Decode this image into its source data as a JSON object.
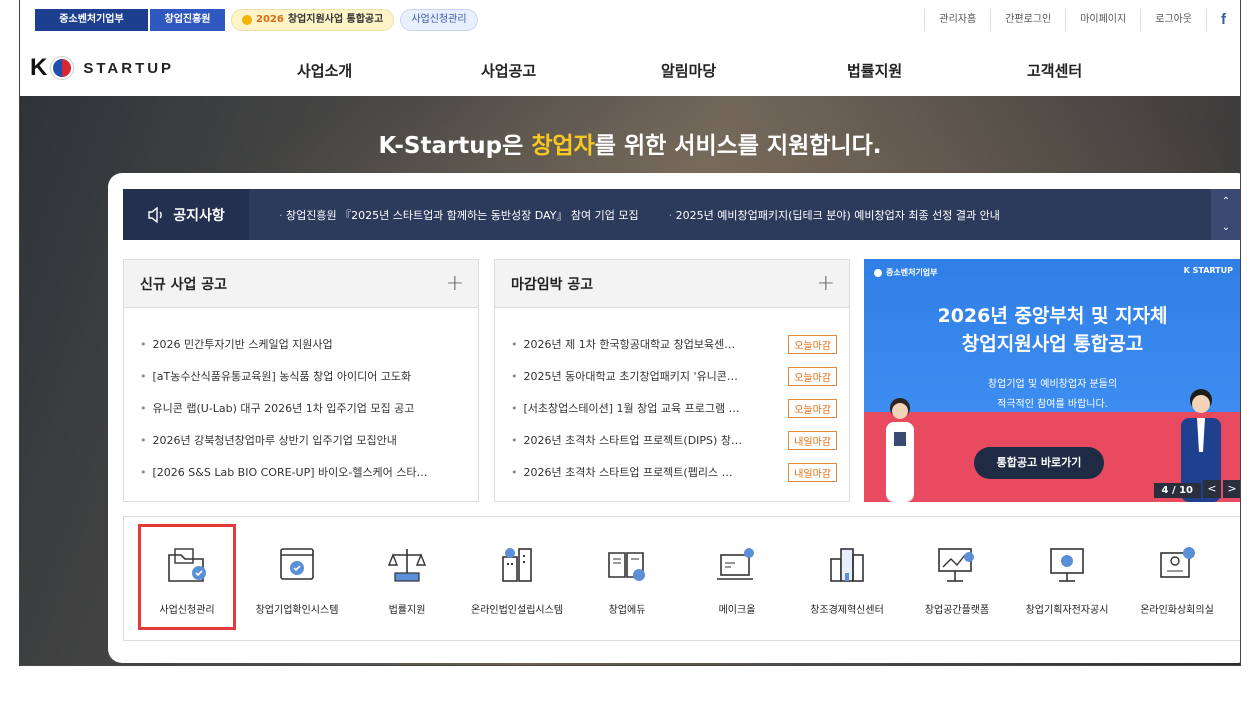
{
  "topbar": {
    "tab1": "중소벤처기업부",
    "tab2": "창업진흥원",
    "pill1_year": "2026",
    "pill1_text": "창업지원사업 통합공고",
    "pill2": "사업신청관리",
    "links": [
      "관리자홈",
      "간편로그인",
      "마이페이지",
      "로그아웃"
    ],
    "fb": "f"
  },
  "nav": {
    "logo_k": "K",
    "logo_text": "STARTUP",
    "menu": [
      "사업소개",
      "사업공고",
      "알림마당",
      "법률지원",
      "고객센터"
    ]
  },
  "hero": {
    "title_pre": "K-Startup은 ",
    "title_hl": "창업자",
    "title_post": "를 위한 서비스를 지원합니다."
  },
  "notice": {
    "label": "공지사항",
    "items": [
      "창업진흥원 『2025년 스타트업과 함께하는 동반성장 DAY』 참여 기업 모집",
      "2025년 예비창업패키지(딥테크 분야) 예비창업자 최종 선정 결과 안내"
    ]
  },
  "new_box": {
    "title": "신규 사업 공고",
    "items": [
      "2026 민간투자기반 스케일업 지원사업",
      "[aT농수산식품유통교육원] 농식품 창업 아이디어 고도화",
      "유니콘 랩(U-Lab) 대구 2026년 1차 입주기업 모집 공고",
      "2026년 강북청년창업마루 상반기 입주기업 모집안내",
      "[2026 S&S Lab BIO CORE-UP] 바이오-헬스케어 스타…"
    ]
  },
  "deadline_box": {
    "title": "마감임박 공고",
    "items": [
      {
        "text": "2026년 제 1차 한국항공대학교 창업보육센…",
        "badge": "오늘마감"
      },
      {
        "text": "2025년 동아대학교 초기창업패키지 '유니콘…",
        "badge": "오늘마감"
      },
      {
        "text": "[서초창업스테이션] 1월 창업 교육 프로그램 …",
        "badge": "오늘마감"
      },
      {
        "text": "2026년 초격차 스타트업 프로젝트(DIPS) 창…",
        "badge": "내일마감"
      },
      {
        "text": "2026년 초격차 스타트업 프로젝트(펩리스 …",
        "badge": "내일마감"
      }
    ]
  },
  "banner": {
    "top_left": "중소벤처기업부",
    "top_right": "K STARTUP",
    "title1": "2026년 중앙부처 및 지자체",
    "title2": "창업지원사업 통합공고",
    "sub1": "창업기업 및 예비창업자 분들의",
    "sub2": "적극적인 참여를 바랍니다.",
    "button": "통합공고 바로가기",
    "page": "4 / 10",
    "prev": "<",
    "next": ">"
  },
  "services": [
    {
      "label": "사업신청관리",
      "icon": "folder-check-icon"
    },
    {
      "label": "창업기업확인시스템",
      "icon": "browser-check-icon"
    },
    {
      "label": "법률지원",
      "icon": "scale-icon"
    },
    {
      "label": "온라인법인설립시스템",
      "icon": "building-icon"
    },
    {
      "label": "창업에듀",
      "icon": "book-icon"
    },
    {
      "label": "메이크올",
      "icon": "laptop-gear-icon"
    },
    {
      "label": "창조경제혁신센터",
      "icon": "city-icon"
    },
    {
      "label": "창업공간플랫폼",
      "icon": "board-icon"
    },
    {
      "label": "창업기획자전자공시",
      "icon": "monitor-icon"
    },
    {
      "label": "온라인화상회의실",
      "icon": "video-meeting-icon"
    }
  ],
  "colors": {
    "navy": "#2c3a5c",
    "accent_yellow": "#f7c823",
    "badge_orange": "#e06a10",
    "selected": "#e23a3a"
  }
}
